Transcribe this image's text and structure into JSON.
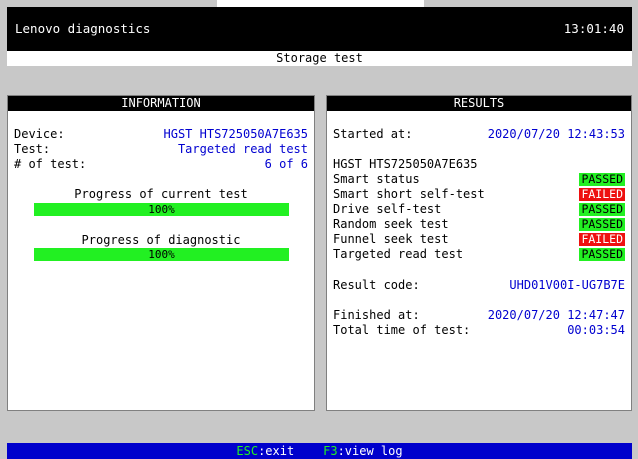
{
  "header": {
    "title": "Lenovo diagnostics",
    "clock": "13:01:40"
  },
  "subheader": {
    "title": "Storage test"
  },
  "information": {
    "heading": "INFORMATION",
    "device_label": "Device:",
    "device_value": "HGST HTS725050A7E635",
    "test_label": "Test:",
    "test_value": "Targeted read test",
    "count_label": "# of test:",
    "count_value": "6 of 6",
    "current_progress_label": "Progress of current test",
    "current_progress_text": "100%",
    "current_progress_value": 100,
    "diag_progress_label": "Progress of diagnostic",
    "diag_progress_text": "100%",
    "diag_progress_value": 100,
    "color_progress": "#22f022"
  },
  "results": {
    "heading": "RESULTS",
    "started_label": "Started at:",
    "started_value": "2020/07/20 12:43:53",
    "device_name": "HGST HTS725050A7E635",
    "tests": [
      {
        "name": "Smart status",
        "status": "PASSED"
      },
      {
        "name": "Smart short self-test",
        "status": "FAILED"
      },
      {
        "name": "Drive self-test",
        "status": "PASSED"
      },
      {
        "name": "Random seek test",
        "status": "PASSED"
      },
      {
        "name": "Funnel seek test",
        "status": "FAILED"
      },
      {
        "name": "Targeted read test",
        "status": "PASSED"
      }
    ],
    "result_code_label": "Result code:",
    "result_code_value": "UHD01V00I-UG7B7E",
    "finished_label": "Finished at:",
    "finished_value": "2020/07/20 12:47:47",
    "total_label": "Total time of test:",
    "total_value": "00:03:54",
    "color_passed": "#22f022",
    "color_failed": "#ee1010"
  },
  "footer": {
    "esc_key": "ESC",
    "esc_action": ":exit",
    "f3_key": "F3",
    "f3_action": ":view log"
  }
}
